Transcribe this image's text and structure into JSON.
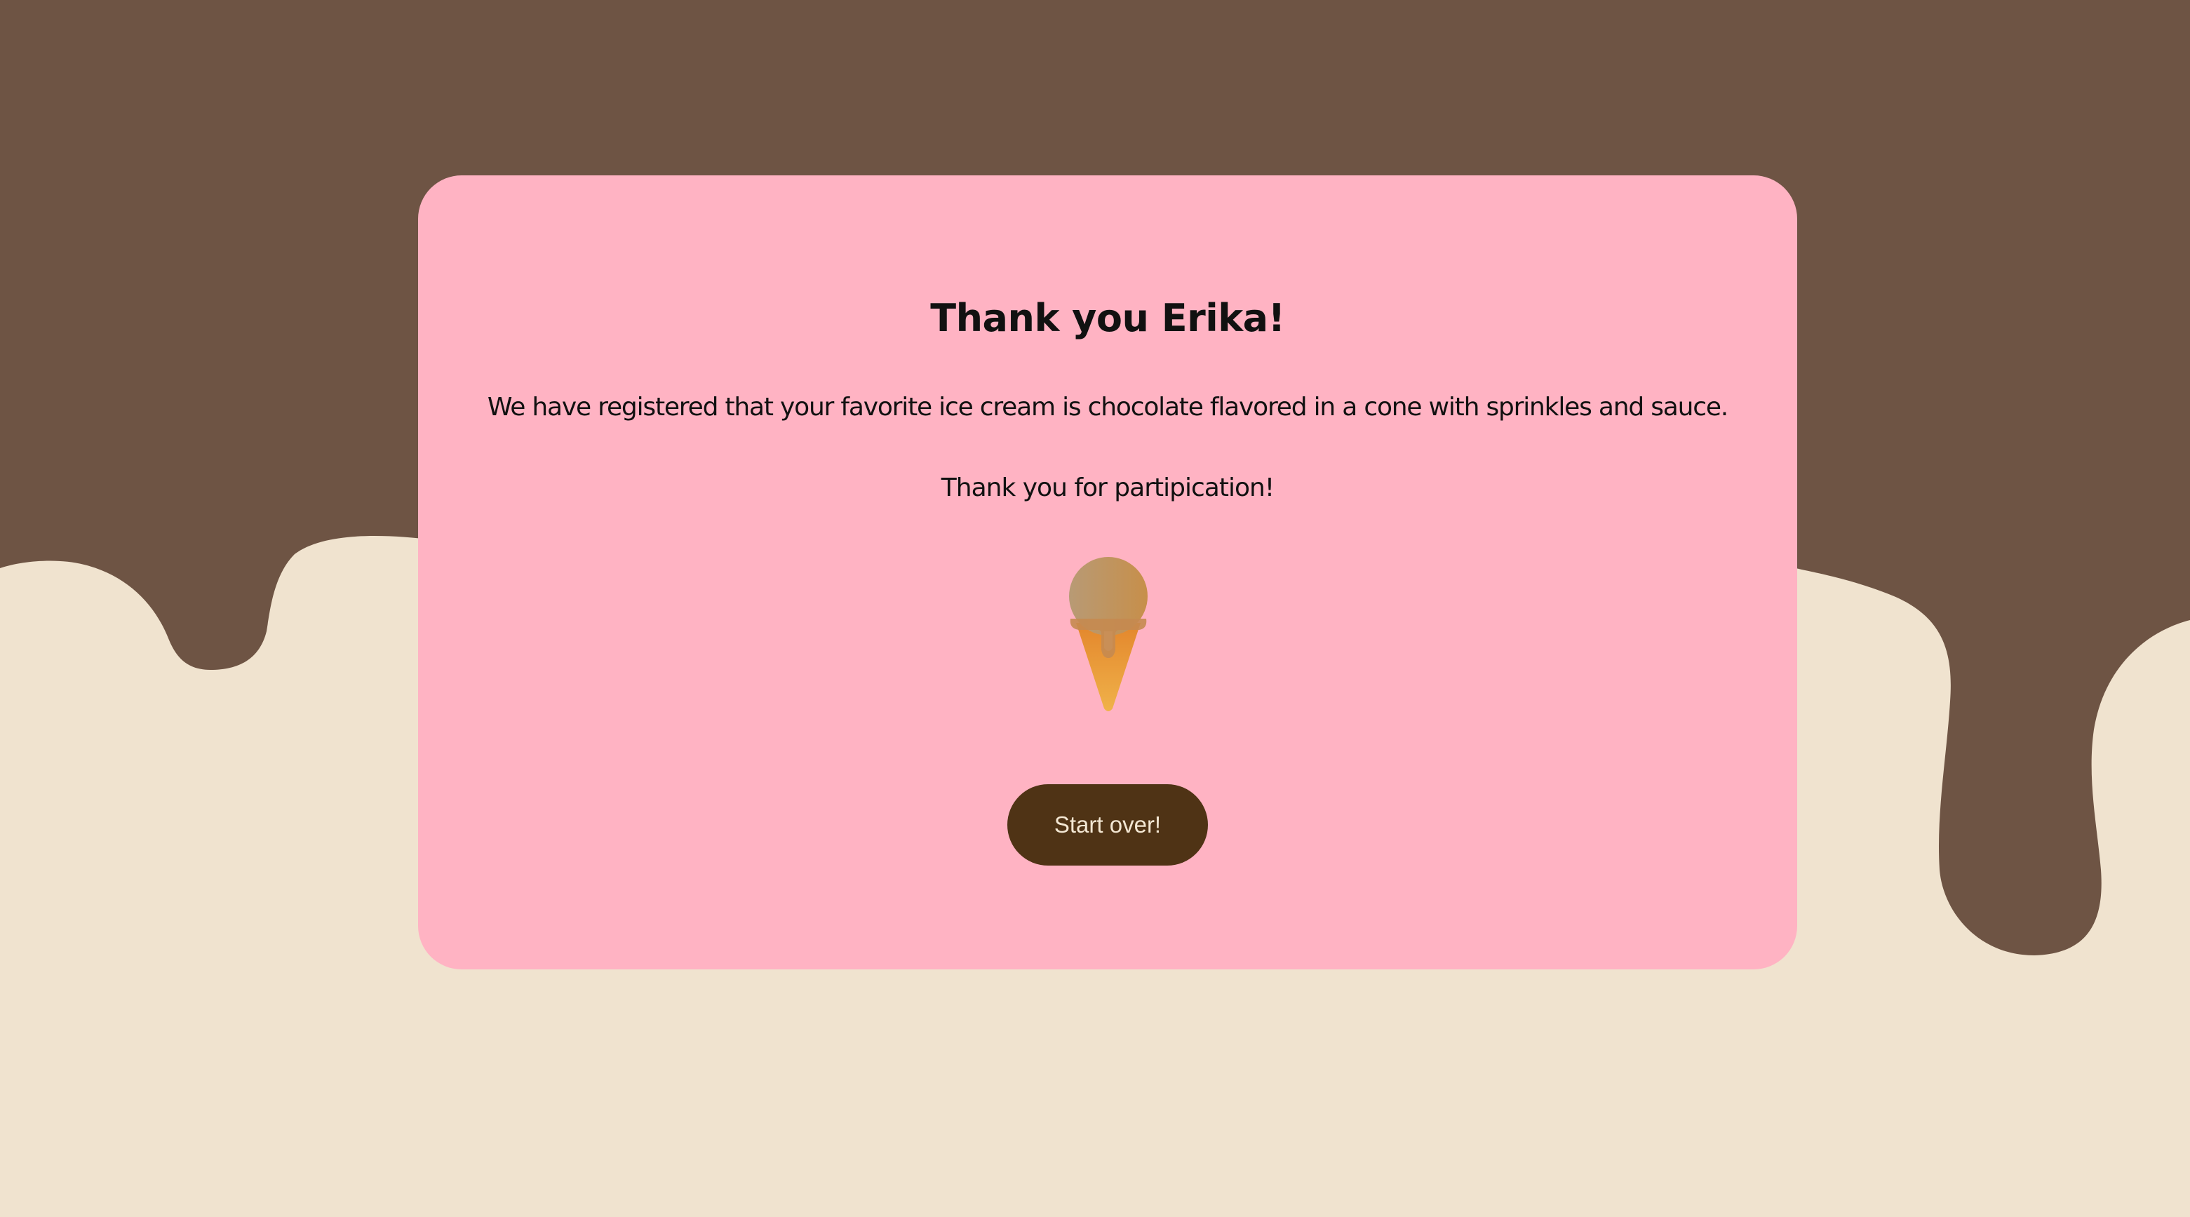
{
  "thank_you": {
    "title": "Thank you Erika!",
    "message": "We have registered that your favorite ice cream is chocolate flavored in a cone with sprinkles and sauce.",
    "participation": "Thank you for partipication!"
  },
  "actions": {
    "start_over_label": "Start over!"
  },
  "icons": {
    "illustration": "ice-cream-cone-icon"
  },
  "colors": {
    "chocolate_drip": "#6e5444",
    "cream_background": "#f0e3cf",
    "card": "#ffb3c3",
    "button": "#4f3315",
    "button_text": "#f3e7d3"
  }
}
